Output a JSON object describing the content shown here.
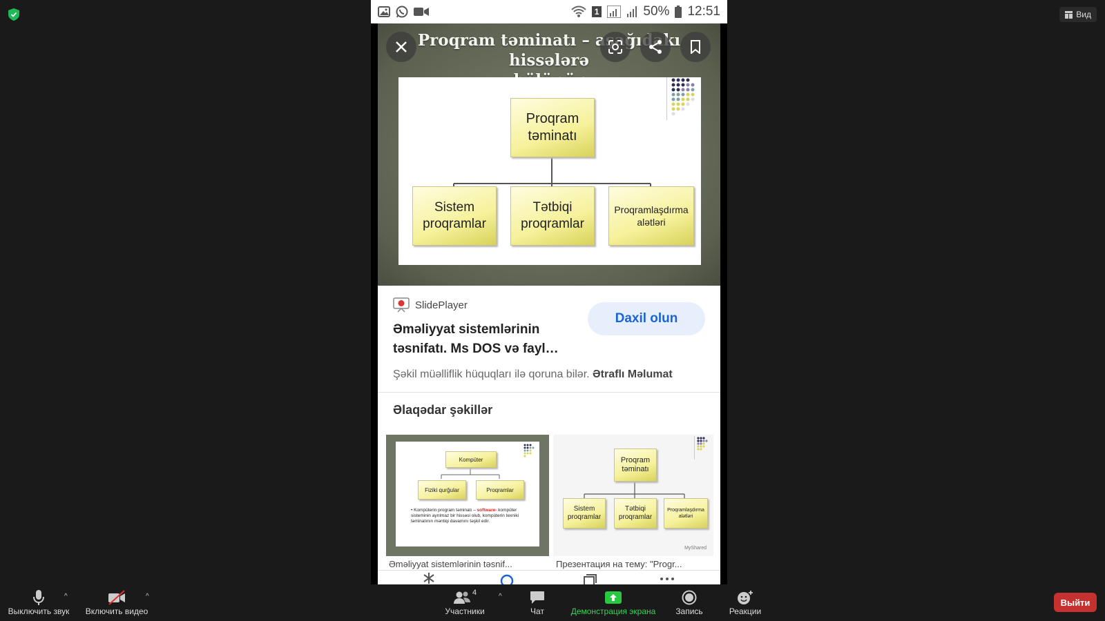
{
  "top": {
    "view_label": "Вид"
  },
  "phone": {
    "status": {
      "battery": "50%",
      "time": "12:51",
      "sim": "1"
    },
    "slide": {
      "title_line1": "Proqram təminatı – aşağıdakı hissələrə",
      "title_line2": "bölünür",
      "root_box": "Proqram təminatı",
      "child_boxes": [
        "Sistem proqramlar",
        "Tətbiqi proqramlar",
        "Proqramlaşdırma alətləri"
      ]
    },
    "info": {
      "source": "SlidePlayer",
      "headline": "Əməliyyat sistemlərinin təsnifatı. Ms DOS və fayl…",
      "login_button": "Daxil olun",
      "copyright": "Şəkil müəlliflik hüquqları ilə qoruna bilər.",
      "more_link": "Ətraflı Məlumat",
      "related_title": "Əlaqədar şəkillər"
    },
    "thumb1": {
      "root": "Kompüter",
      "left": "Fiziki qurğular",
      "right": "Proqramlar",
      "note_pre": "Kompüterin program təminatı –",
      "note_highlight": "software-",
      "note_post": "kompüter sisteminin ayrılmaz bir hissəsi olub, kompüterin texniki təminatının məntiqi davamını təşkil edir.",
      "caption": "Əməliyyat sistemlərinin təsnif..."
    },
    "thumb2": {
      "root": "Proqram təminatı",
      "children": [
        "Sistem proqramlar",
        "Tətbiqi proqramlar",
        "Proqramlaşdırma alətləri"
      ],
      "watermark": "MyShared",
      "caption": "Презентация на тему: \"Progr..."
    }
  },
  "toolbar": {
    "mute": "Выключить звук",
    "video": "Включить видео",
    "participants": "Участники",
    "participants_count": "4",
    "chat": "Чат",
    "share": "Демонстрация экрана",
    "record": "Запись",
    "reactions": "Реакции",
    "exit": "Выйти"
  },
  "colors": {
    "accent_green": "#28c840",
    "exit_red": "#c4312e",
    "login_blue": "#1a63d8"
  }
}
